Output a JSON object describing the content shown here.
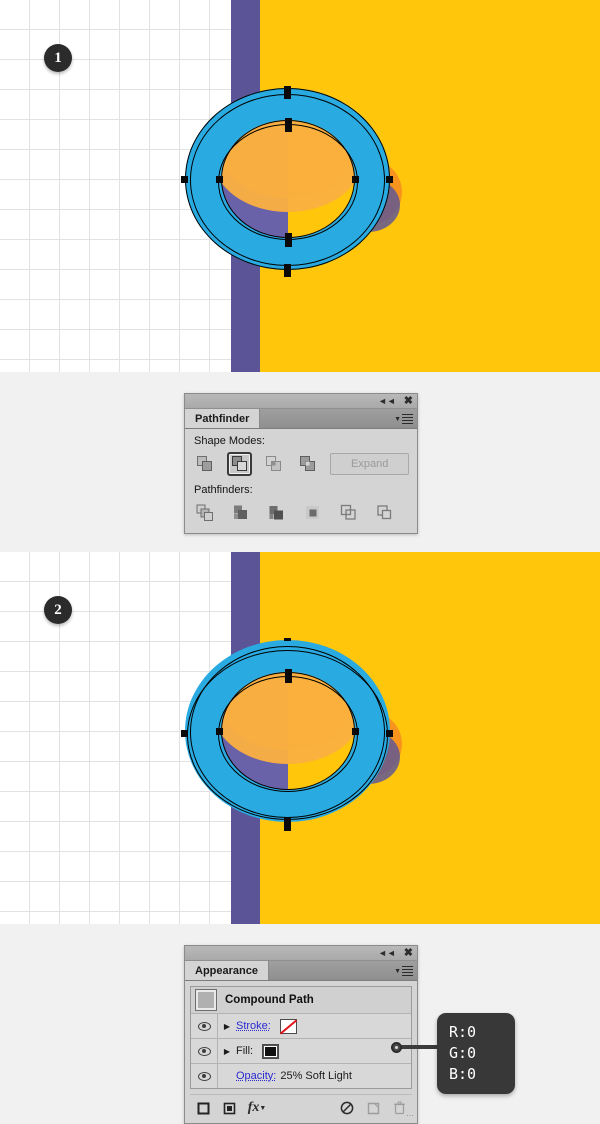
{
  "steps": [
    {
      "number": "1"
    },
    {
      "number": "2"
    }
  ],
  "colors": {
    "blue_ring": "#29abe2",
    "yellow_field": "#ffc60b",
    "purple_band": "#5b5497",
    "orange_shade": "#f7941e",
    "anchor": "#0a0a0a",
    "badge_bg": "#2b2b2b",
    "panel_bg": "#d4d4d4",
    "link_blue": "#2a2ad0",
    "none_red": "#e0141b"
  },
  "pathfinder_panel": {
    "tab_label": "Pathfinder",
    "collapse_icon": "collapse-double-chevron-icon",
    "close_icon": "close-x-icon",
    "menu_icon": "panel-menu-icon",
    "shape_modes_label": "Shape Modes:",
    "pathfinders_label": "Pathfinders:",
    "expand_label": "Expand",
    "shape_modes": [
      {
        "name": "unite",
        "selected": false
      },
      {
        "name": "minus-front",
        "selected": true
      },
      {
        "name": "intersect",
        "selected": false
      },
      {
        "name": "exclude",
        "selected": false
      }
    ],
    "pathfinders": [
      {
        "name": "divide"
      },
      {
        "name": "trim"
      },
      {
        "name": "merge"
      },
      {
        "name": "crop"
      },
      {
        "name": "outline"
      },
      {
        "name": "minus-back"
      }
    ]
  },
  "appearance_panel": {
    "tab_label": "Appearance",
    "collapse_icon": "collapse-double-chevron-icon",
    "close_icon": "close-x-icon",
    "menu_icon": "panel-menu-icon",
    "object_title": "Compound Path",
    "rows": [
      {
        "label": "Stroke:",
        "swatch": "none",
        "has_arrow": true,
        "eye": true
      },
      {
        "label": "Fill:",
        "swatch": "black",
        "has_arrow": true,
        "eye": true
      }
    ],
    "opacity_label": "Opacity:",
    "opacity_value": "25% Soft Light",
    "footer_icons": [
      {
        "name": "add-new-stroke-icon"
      },
      {
        "name": "add-new-fill-icon"
      },
      {
        "name": "add-new-effect-fx-icon"
      },
      {
        "name": "clear-appearance-icon"
      },
      {
        "name": "duplicate-item-icon"
      },
      {
        "name": "delete-item-icon"
      }
    ]
  },
  "callout": {
    "r": "R:0",
    "g": "G:0",
    "b": "B:0"
  }
}
